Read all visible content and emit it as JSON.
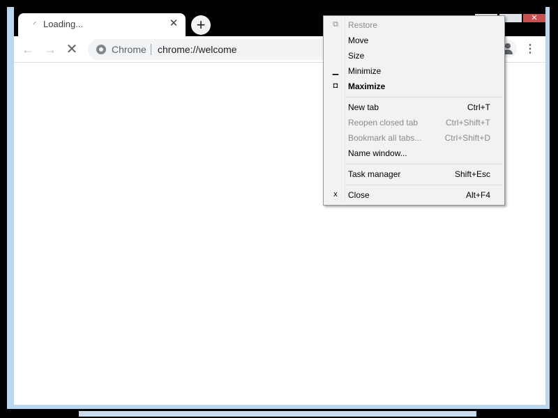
{
  "tab": {
    "title": "Loading...",
    "close_glyph": "✕",
    "spinner_glyph": "◜",
    "new_tab_glyph": "+"
  },
  "caption": {
    "close_glyph": "✕"
  },
  "toolbar": {
    "back_glyph": "←",
    "forward_glyph": "→",
    "stop_glyph": "✕",
    "site_chip": "Chrome",
    "url": "chrome://welcome",
    "menu_glyph": "⋮"
  },
  "system_menu": {
    "items": [
      {
        "glyph": "⧉",
        "label": "Restore",
        "shortcut": "",
        "disabled": true,
        "bold": false
      },
      {
        "glyph": "",
        "label": "Move",
        "shortcut": "",
        "disabled": false,
        "bold": false
      },
      {
        "glyph": "",
        "label": "Size",
        "shortcut": "",
        "disabled": false,
        "bold": false
      },
      {
        "glyph": "▁",
        "label": "Minimize",
        "shortcut": "",
        "disabled": false,
        "bold": false
      },
      {
        "glyph": "◘",
        "label": "Maximize",
        "shortcut": "",
        "disabled": false,
        "bold": true
      },
      {
        "glyph": "",
        "label": "New tab",
        "shortcut": "Ctrl+T",
        "disabled": false,
        "bold": false
      },
      {
        "glyph": "",
        "label": "Reopen closed tab",
        "shortcut": "Ctrl+Shift+T",
        "disabled": true,
        "bold": false
      },
      {
        "glyph": "",
        "label": "Bookmark all tabs...",
        "shortcut": "Ctrl+Shift+D",
        "disabled": true,
        "bold": false
      },
      {
        "glyph": "",
        "label": "Name window...",
        "shortcut": "",
        "disabled": false,
        "bold": false
      },
      {
        "glyph": "",
        "label": "Task manager",
        "shortcut": "Shift+Esc",
        "disabled": false,
        "bold": false
      },
      {
        "glyph": "x",
        "label": "Close",
        "shortcut": "Alt+F4",
        "disabled": false,
        "bold": false
      }
    ]
  },
  "colors": {
    "window_frame": "#bcd6ec",
    "tabstrip": "#000000",
    "menu_background": "#f2f2f2",
    "disabled_text": "#8a8a8a",
    "caption_close": "#c75050"
  }
}
